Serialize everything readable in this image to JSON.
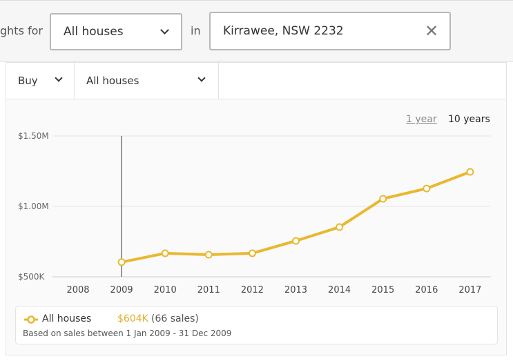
{
  "search": {
    "prefix": "ghts for",
    "property_type": "All houses",
    "in_label": "in",
    "location": "Kirrawee, NSW 2232"
  },
  "filters": {
    "mode": "Buy",
    "type": "All houses"
  },
  "range": {
    "one_year": "1 year",
    "ten_years": "10 years",
    "selected": "10 years"
  },
  "legend": {
    "series": "All houses",
    "value": "$604K",
    "sales": "(66 sales)",
    "note": "Based on sales between 1 Jan 2009 - 31 Dec 2009"
  },
  "colors": {
    "series": "#e8b830",
    "accent_text": "#e0b030"
  },
  "chart_data": {
    "type": "line",
    "x": [
      2009,
      2010,
      2011,
      2012,
      2013,
      2014,
      2015,
      2016,
      2017
    ],
    "series": [
      {
        "name": "All houses",
        "values": [
          604,
          667,
          657,
          667,
          755,
          853,
          1054,
          1127,
          1245
        ]
      }
    ],
    "x_ticks": [
      "2008",
      "2009",
      "2010",
      "2011",
      "2012",
      "2013",
      "2014",
      "2015",
      "2016",
      "2017"
    ],
    "y_ticks": [
      {
        "value": 500,
        "label": "$500K"
      },
      {
        "value": 1000,
        "label": "$1.00M"
      },
      {
        "value": 1500,
        "label": "$1.50M"
      }
    ],
    "ylim": [
      500,
      1500
    ],
    "xlim": [
      2008,
      2017
    ],
    "grid": true,
    "selected_x": 2009,
    "y_unit": "thousand AUD"
  }
}
